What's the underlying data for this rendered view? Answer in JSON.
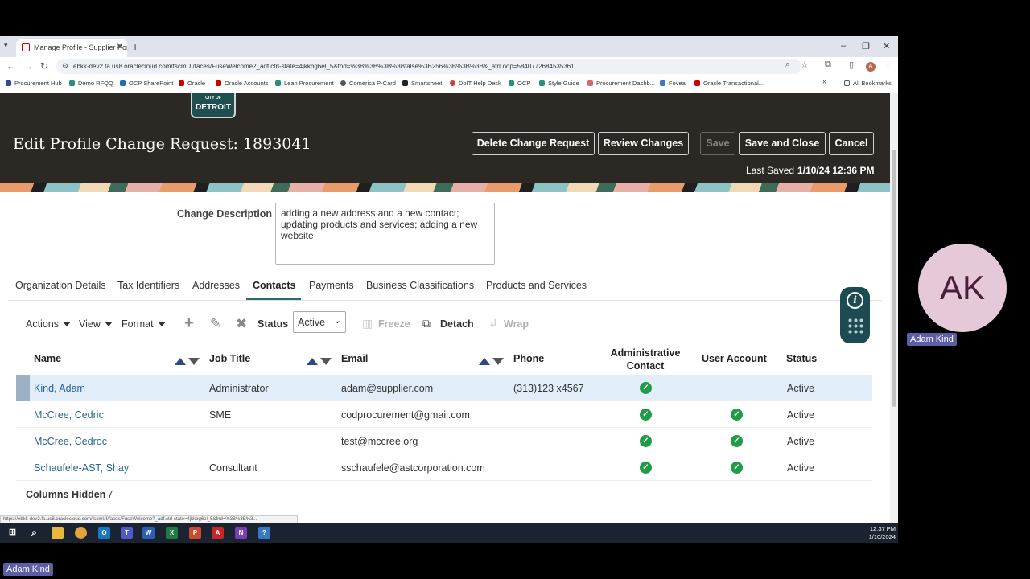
{
  "browser": {
    "tab_title": "Manage Profile - Supplier Portal",
    "new_tab": "+",
    "url": "ebkk-dev2.fa.us8.oraclecloud.com/fscmUI/faces/FuseWelcome?_adf.ctrl-state=4jkkbg6el_5&fnd=%3B%3B%3B%3Bfalse%3B256%3B%3B%3B&_afrLoop=5840772684535361",
    "profile_initial": "A",
    "bookmarks": [
      "Procurement Hub",
      "Demo RFQQ",
      "OCP SharePoint",
      "Oracle",
      "Oracle Accounts",
      "Lean Procurement",
      "Comerica P-Card",
      "Smartsheet",
      "DoIT Help Desk",
      "OCP",
      "Style Guide",
      "Procurement Dashb...",
      "Fovea",
      "Oracle Transactional..."
    ],
    "all_bookmarks": "All Bookmarks",
    "status_url": "https://ebkk-dev2.fa.us8.oraclecloud.com/fscmUI/faces/FuseWelcome?_adf.ctrl-state=4jkkbg6el_5&fnd=%3B%3B%3..."
  },
  "header": {
    "logo_small": "CITY OF",
    "logo_text": "DETROIT",
    "title": "Edit Profile Change Request: 1893041",
    "buttons": {
      "delete": "Delete Change Request",
      "review": "Review Changes",
      "save": "Save",
      "save_close": "Save and Close",
      "cancel": "Cancel"
    },
    "last_saved_label": "Last Saved",
    "last_saved_value": "1/10/24 12:36 PM"
  },
  "change_description": {
    "label": "Change Description",
    "value": "adding a new address and a new contact; updating products and services; adding a new website"
  },
  "tabs": [
    "Organization Details",
    "Tax Identifiers",
    "Addresses",
    "Contacts",
    "Payments",
    "Business Classifications",
    "Products and Services"
  ],
  "active_tab": "Contacts",
  "toolbar": {
    "actions": "Actions",
    "view": "View",
    "format": "Format",
    "status_label": "Status",
    "status_value": "Active",
    "freeze": "Freeze",
    "detach": "Detach",
    "wrap": "Wrap"
  },
  "table": {
    "columns": [
      "Name",
      "Job Title",
      "Email",
      "Phone",
      "Administrative Contact",
      "User Account",
      "Status"
    ],
    "rows": [
      {
        "name": "Kind, Adam",
        "job": "Administrator",
        "email": "adam@supplier.com",
        "phone": "(313)123 x4567",
        "admin": true,
        "user": false,
        "status": "Active"
      },
      {
        "name": "McCree, Cedric",
        "job": "SME",
        "email": "codprocurement@gmail.com",
        "phone": "",
        "admin": true,
        "user": true,
        "status": "Active"
      },
      {
        "name": "McCree, Cedroc",
        "job": "",
        "email": "test@mccree.org",
        "phone": "",
        "admin": true,
        "user": true,
        "status": "Active"
      },
      {
        "name": "Schaufele-AST, Shay",
        "job": "Consultant",
        "email": "sschaufele@astcorporation.com",
        "phone": "",
        "admin": true,
        "user": true,
        "status": "Active"
      }
    ],
    "columns_hidden_label": "Columns Hidden",
    "columns_hidden_count": "7"
  },
  "taskbar": {
    "time": "12:37 PM",
    "date": "1/10/2024"
  },
  "participant": {
    "initials": "AK",
    "name": "Adam Kind"
  },
  "colors": {
    "header_bg": "#2c2823",
    "link": "#2a6496",
    "check": "#1f9d46",
    "selected_row": "#e1eef9"
  }
}
